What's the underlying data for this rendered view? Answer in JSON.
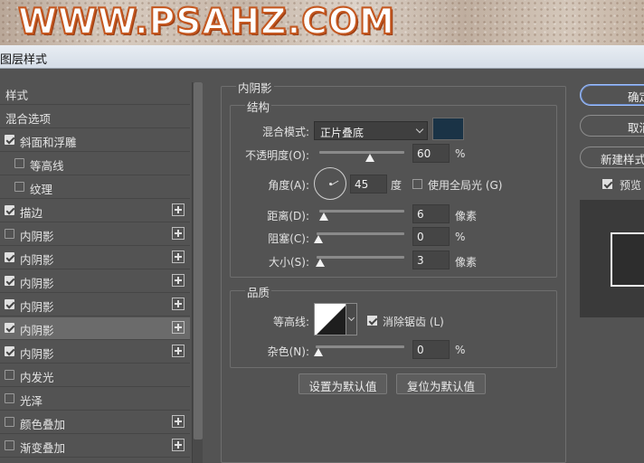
{
  "watermark": "WWW.PSAHZ.COM",
  "dialog": {
    "title": "图层样式"
  },
  "sidebar": {
    "items": [
      {
        "label": "样式",
        "checkbox": false,
        "checked": false,
        "plus": false,
        "indent": false,
        "selected": false
      },
      {
        "label": "混合选项",
        "checkbox": false,
        "checked": false,
        "plus": false,
        "indent": false,
        "selected": false
      },
      {
        "label": "斜面和浮雕",
        "checkbox": true,
        "checked": true,
        "plus": false,
        "indent": false,
        "selected": false
      },
      {
        "label": "等高线",
        "checkbox": true,
        "checked": false,
        "plus": false,
        "indent": true,
        "selected": false
      },
      {
        "label": "纹理",
        "checkbox": true,
        "checked": false,
        "plus": false,
        "indent": true,
        "selected": false
      },
      {
        "label": "描边",
        "checkbox": true,
        "checked": true,
        "plus": true,
        "indent": false,
        "selected": false
      },
      {
        "label": "内阴影",
        "checkbox": true,
        "checked": false,
        "plus": true,
        "indent": false,
        "selected": false
      },
      {
        "label": "内阴影",
        "checkbox": true,
        "checked": true,
        "plus": true,
        "indent": false,
        "selected": false
      },
      {
        "label": "内阴影",
        "checkbox": true,
        "checked": true,
        "plus": true,
        "indent": false,
        "selected": false
      },
      {
        "label": "内阴影",
        "checkbox": true,
        "checked": true,
        "plus": true,
        "indent": false,
        "selected": false
      },
      {
        "label": "内阴影",
        "checkbox": true,
        "checked": true,
        "plus": true,
        "indent": false,
        "selected": true
      },
      {
        "label": "内阴影",
        "checkbox": true,
        "checked": true,
        "plus": true,
        "indent": false,
        "selected": false
      },
      {
        "label": "内发光",
        "checkbox": true,
        "checked": false,
        "plus": false,
        "indent": false,
        "selected": false
      },
      {
        "label": "光泽",
        "checkbox": true,
        "checked": false,
        "plus": false,
        "indent": false,
        "selected": false
      },
      {
        "label": "颜色叠加",
        "checkbox": true,
        "checked": false,
        "plus": true,
        "indent": false,
        "selected": false
      },
      {
        "label": "渐变叠加",
        "checkbox": true,
        "checked": false,
        "plus": true,
        "indent": false,
        "selected": false
      }
    ]
  },
  "panel": {
    "title": "内阴影",
    "structure": {
      "legend": "结构",
      "blend_mode_label": "混合模式:",
      "blend_mode_value": "正片叠底",
      "shadow_color": "#1a3346",
      "opacity_label": "不透明度(O):",
      "opacity_value": "60",
      "opacity_unit": "%",
      "opacity_level": 0.6,
      "angle_label": "角度(A):",
      "angle_value": "45",
      "angle_unit": "度",
      "global_light_label": "使用全局光 (G)",
      "global_light_checked": false,
      "distance_label": "距离(D):",
      "distance_value": "6",
      "distance_unit": "像素",
      "choke_label": "阻塞(C):",
      "choke_value": "0",
      "choke_unit": "%",
      "size_label": "大小(S):",
      "size_value": "3",
      "size_unit": "像素"
    },
    "quality": {
      "legend": "品质",
      "contour_label": "等高线:",
      "antialias_label": "消除锯齿 (L)",
      "antialias_checked": true,
      "noise_label": "杂色(N):",
      "noise_value": "0",
      "noise_unit": "%"
    },
    "set_default_label": "设置为默认值",
    "reset_default_label": "复位为默认值"
  },
  "actions": {
    "ok_label": "确定",
    "cancel_label": "取消",
    "new_style_label": "新建样式",
    "preview_label": "预览",
    "preview_checked": true
  }
}
